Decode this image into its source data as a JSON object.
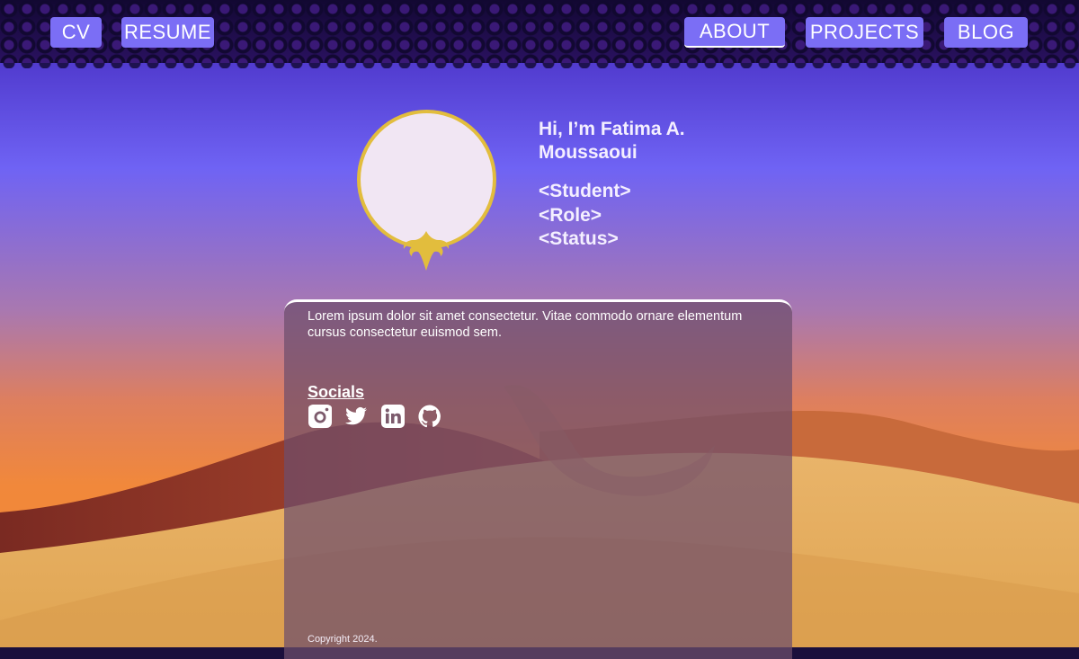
{
  "nav": {
    "left": [
      {
        "label": "CV"
      },
      {
        "label": "RESUME"
      }
    ],
    "right": [
      {
        "label": "ABOUT"
      },
      {
        "label": "PROJECTS"
      },
      {
        "label": "BLOG"
      }
    ]
  },
  "hero": {
    "greeting": "Hi, I’m Fatima A. Moussaoui",
    "roles": [
      "<Student>",
      "<Role>",
      "<Status>"
    ]
  },
  "card": {
    "about": "Lorem ipsum dolor sit amet consectetur. Vitae commodo ornare elementum cursus consectetur euismod sem.",
    "socials_title": "Socials",
    "socials": [
      {
        "icon": "instagram-icon"
      },
      {
        "icon": "twitter-icon"
      },
      {
        "icon": "linkedin-icon"
      },
      {
        "icon": "github-icon"
      }
    ],
    "copyright": "Copyright 2024."
  },
  "colors": {
    "nav_button": "#7b6ef5",
    "accent_gold": "#e2bd3d",
    "portrait_fill": "#f1e6f3"
  }
}
